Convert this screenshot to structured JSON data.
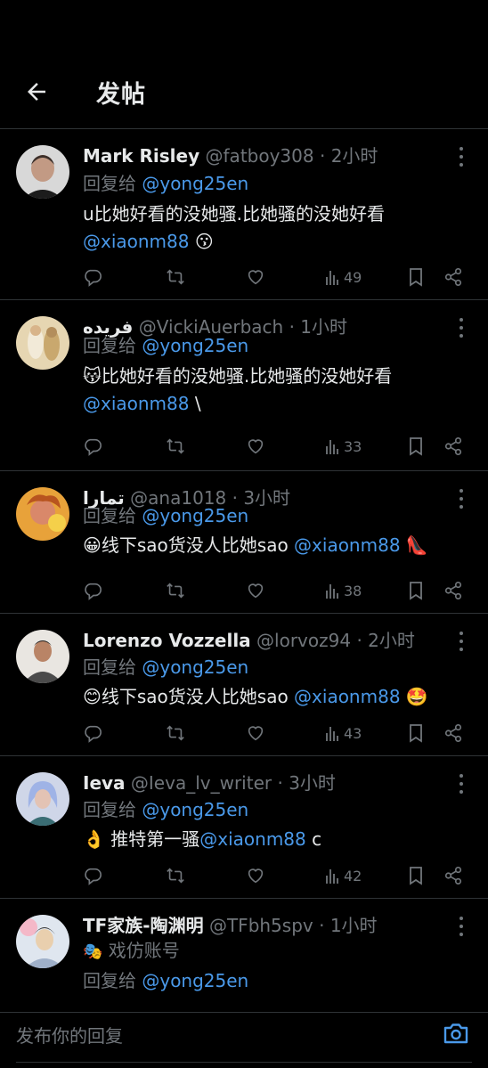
{
  "header": {
    "title": "发帖"
  },
  "composer": {
    "placeholder": "发布你的回复"
  },
  "tweets": [
    {
      "name": "Mark Risley",
      "handle": "@fatboy308",
      "dot": "·",
      "time": "2小时",
      "reply_prefix": "回复给",
      "reply_to": "@yong25en",
      "text": "u比她好看的没她骚.比她骚的没她好看",
      "mention": "@xiaonm88",
      "emoji_after": "😗",
      "views": "49"
    },
    {
      "name": "فريده",
      "handle": "@VickiAuerbach",
      "dot": "·",
      "time": "1小时",
      "reply_prefix": "回复给",
      "reply_to": "@yong25en",
      "emoji_before": "😽",
      "text": "比她好看的没她骚.比她骚的没她好看",
      "mention": "@xiaonm88",
      "trail": "\\",
      "views": "33"
    },
    {
      "name": "تمارا",
      "handle": "@ana1018",
      "dot": "·",
      "time": "3小时",
      "reply_prefix": "回复给",
      "reply_to": "@yong25en",
      "emoji_before": "😀",
      "text": "线下sao货没人比她sao",
      "mention": "@xiaonm88",
      "emoji_after": "👠",
      "views": "38"
    },
    {
      "name": "Lorenzo Vozzella",
      "handle": "@lorvoz94",
      "dot": "·",
      "time": "2小时",
      "reply_prefix": "回复给",
      "reply_to": "@yong25en",
      "emoji_before": "😊",
      "text": "线下sao货没人比她sao",
      "mention": "@xiaonm88",
      "emoji_after": "🤩",
      "views": "43"
    },
    {
      "name": "Ieva",
      "handle": "@Ieva_lv_writer",
      "dot": "·",
      "time": "3小时",
      "reply_prefix": "回复给",
      "reply_to": "@yong25en",
      "emoji_before": "👌",
      "text": "推特第一骚",
      "mention": "@xiaonm88",
      "trail": "c",
      "views": "42"
    },
    {
      "name": "TF家族-陶渊明",
      "handle": "@TFbh5spv",
      "dot": "·",
      "time": "1小时",
      "label_emoji": "🎭",
      "label": "戏仿账号",
      "reply_prefix": "回复给",
      "reply_to": "@yong25en"
    }
  ],
  "colors": {
    "background": "#000000",
    "accent": "#4a99e9",
    "muted": "#71767b",
    "divider": "#2f3336"
  },
  "icons": [
    "arrow-left-icon",
    "more-vertical-icon",
    "reply-icon",
    "retweet-icon",
    "like-icon",
    "views-icon",
    "bookmark-icon",
    "share-icon",
    "camera-icon"
  ]
}
